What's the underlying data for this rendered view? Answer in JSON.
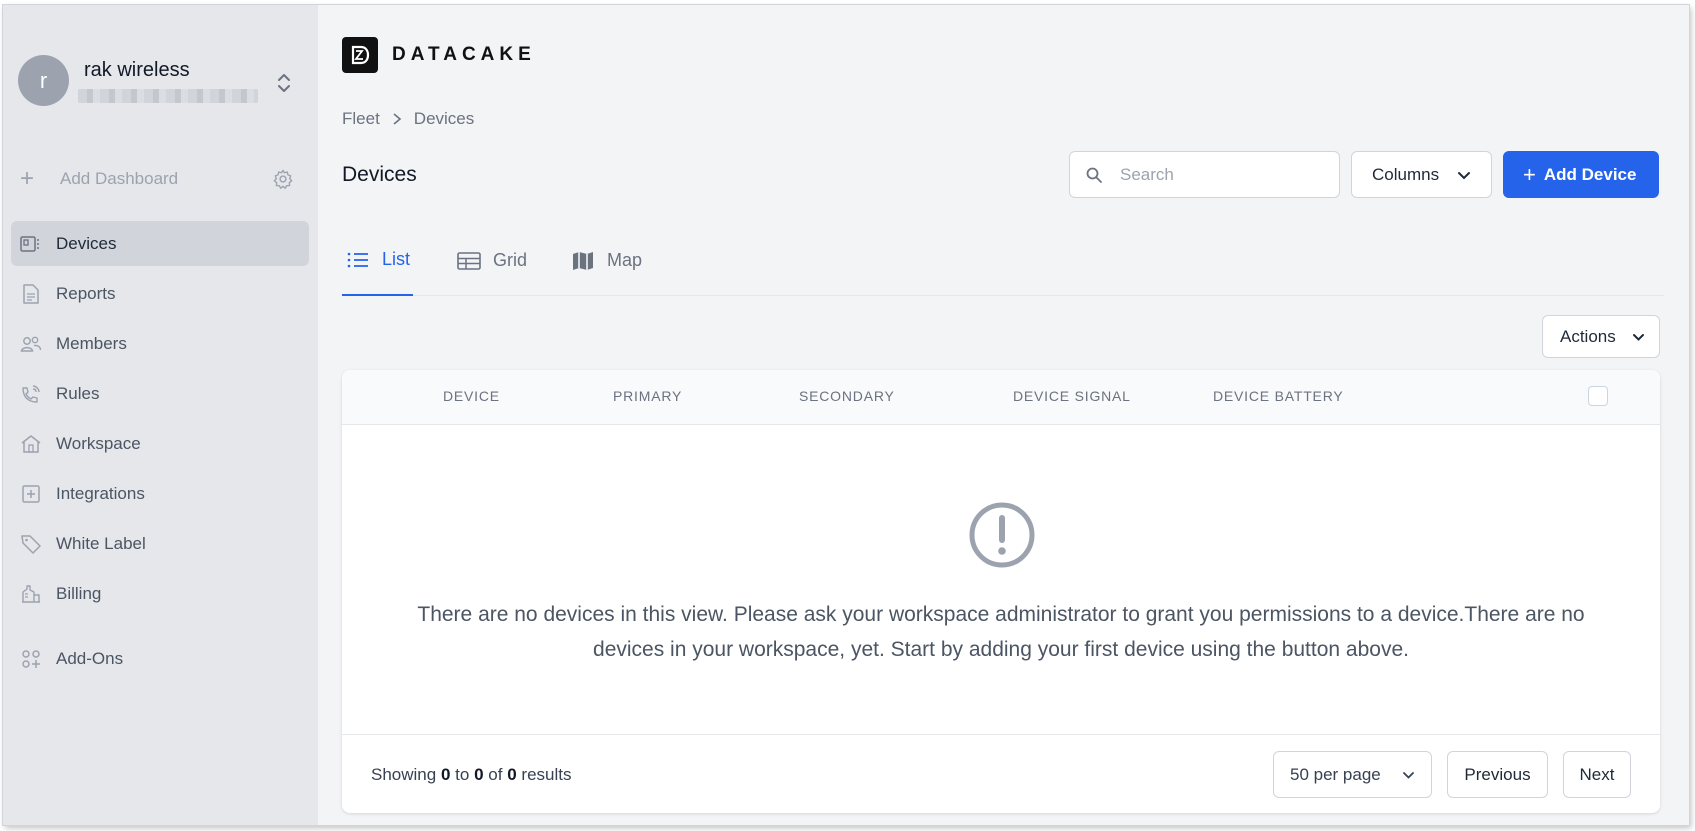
{
  "account": {
    "avatar_letter": "r",
    "name": "rak wireless"
  },
  "sidebar": {
    "add_dashboard": "Add Dashboard",
    "items": [
      {
        "label": "Devices",
        "icon": "devices-icon",
        "active": true
      },
      {
        "label": "Reports",
        "icon": "reports-icon"
      },
      {
        "label": "Members",
        "icon": "members-icon"
      },
      {
        "label": "Rules",
        "icon": "rules-icon"
      },
      {
        "label": "Workspace",
        "icon": "workspace-icon"
      },
      {
        "label": "Integrations",
        "icon": "integrations-icon"
      },
      {
        "label": "White Label",
        "icon": "tag-icon"
      },
      {
        "label": "Billing",
        "icon": "billing-icon"
      },
      {
        "label": "Add-Ons",
        "icon": "addons-icon"
      }
    ]
  },
  "header": {
    "logo_text": "DATACAKE",
    "breadcrumb": [
      "Fleet",
      "Devices"
    ],
    "title": "Devices"
  },
  "toolbar": {
    "search_placeholder": "Search",
    "columns_label": "Columns",
    "add_device_label": "Add Device"
  },
  "tabs": [
    {
      "label": "List",
      "icon": "list-icon",
      "active": true
    },
    {
      "label": "Grid",
      "icon": "grid-icon"
    },
    {
      "label": "Map",
      "icon": "map-icon"
    }
  ],
  "actions_label": "Actions",
  "table": {
    "columns": [
      "DEVICE",
      "PRIMARY",
      "SECONDARY",
      "DEVICE SIGNAL",
      "DEVICE BATTERY"
    ],
    "rows": [],
    "empty_message": "There are no devices in this view. Please ask your workspace administrator to grant you permissions to a device.There are no devices in your workspace, yet. Start by adding your first device using the button above."
  },
  "pagination": {
    "showing": "Showing",
    "from": "0",
    "to_word": "to",
    "to": "0",
    "of_word": "of",
    "total": "0",
    "results_word": "results",
    "per_page": "50 per page",
    "previous_label": "Previous",
    "next_label": "Next"
  },
  "colors": {
    "accent": "#2563eb",
    "sidebar_bg": "#e5e7eb",
    "main_bg": "#f3f4f6"
  }
}
